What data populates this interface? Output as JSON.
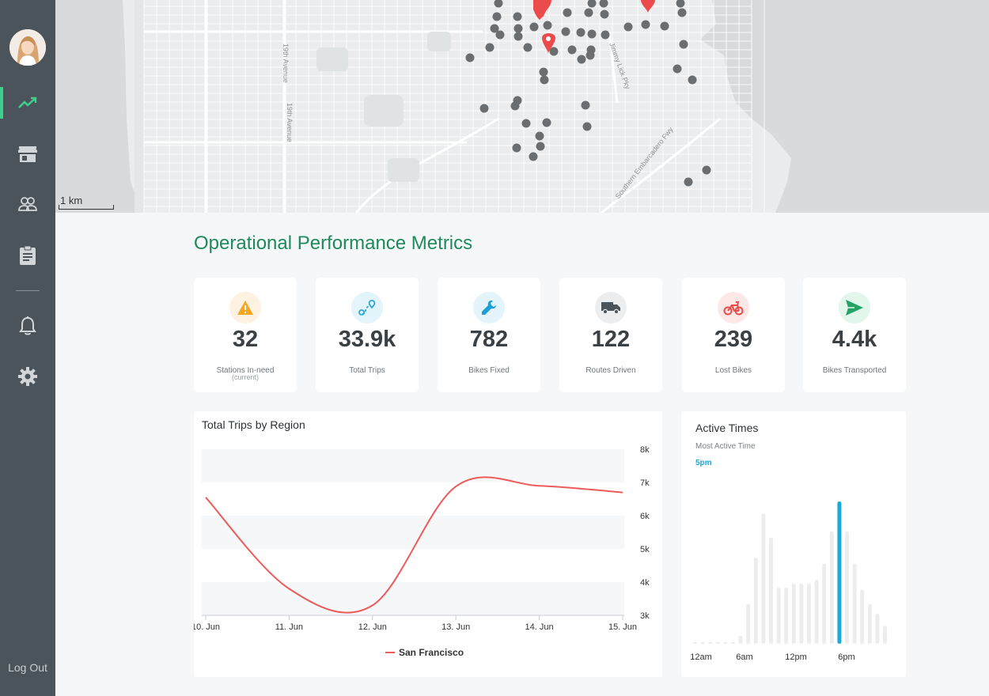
{
  "sidebar": {
    "items": [
      {
        "icon": "trending-up-icon",
        "active": true
      },
      {
        "icon": "store-icon",
        "active": false
      },
      {
        "icon": "users-icon",
        "active": false
      },
      {
        "icon": "clipboard-icon",
        "active": false
      },
      {
        "icon": "bell-icon",
        "active": false
      },
      {
        "icon": "gear-icon",
        "active": false
      }
    ],
    "logout_label": "Log Out"
  },
  "map": {
    "scale_label": "1 km",
    "street_labels": [
      "19th Avenue",
      "19th Avenue",
      "Jimmy Lick Pky",
      "Southern Embarcadero Fwy"
    ]
  },
  "section_title": "Operational Performance Metrics",
  "metrics": [
    {
      "value": "32",
      "label": "Stations In-need",
      "sublabel": "(current)",
      "icon": "warning-icon",
      "icon_bg": "#fdf1e1",
      "icon_color": "#f5a623"
    },
    {
      "value": "33.9k",
      "label": "Total Trips",
      "icon": "route-icon",
      "icon_bg": "#e3f4fb",
      "icon_color": "#2aa8d8"
    },
    {
      "value": "782",
      "label": "Bikes Fixed",
      "icon": "wrench-icon",
      "icon_bg": "#e3f4fb",
      "icon_color": "#1a9fd6"
    },
    {
      "value": "122",
      "label": "Routes Driven",
      "icon": "truck-icon",
      "icon_bg": "#ebedee",
      "icon_color": "#4a545a"
    },
    {
      "value": "239",
      "label": "Lost Bikes",
      "icon": "bike-icon",
      "icon_bg": "#fde7e7",
      "icon_color": "#ec4b4b"
    },
    {
      "value": "4.4k",
      "label": "Bikes Transported",
      "icon": "send-icon",
      "icon_bg": "#e2f6ec",
      "icon_color": "#21a566"
    }
  ],
  "trips_chart": {
    "title": "Total Trips by Region",
    "chart_data": {
      "type": "line",
      "x": [
        "10. Jun",
        "11. Jun",
        "12. Jun",
        "13. Jun",
        "14. Jun",
        "15. Jun"
      ],
      "series": [
        {
          "name": "San Francisco",
          "values": [
            6550,
            3800,
            3300,
            6880,
            6900,
            6700
          ],
          "color": "#ec5a5a"
        }
      ],
      "y_ticks": [
        "3k",
        "4k",
        "5k",
        "6k",
        "7k",
        "8k"
      ],
      "ylim": [
        3000,
        8000
      ],
      "legend": "bottom-center",
      "grid": "alternating-bands"
    }
  },
  "active_times": {
    "title": "Active Times",
    "subtitle": "Most Active Time",
    "highlight": "5pm",
    "highlight_color": "#1aa9d8",
    "chart_data": {
      "type": "bar",
      "x_ticks": [
        "12am",
        "6am",
        "12pm",
        "6pm"
      ],
      "values": [
        1,
        1,
        1,
        1,
        1,
        1,
        4,
        20,
        43,
        65,
        53,
        28,
        28,
        30,
        30,
        30,
        32,
        40,
        56,
        71,
        56,
        40,
        27,
        20,
        15,
        9
      ],
      "highlight_index": 19
    }
  }
}
